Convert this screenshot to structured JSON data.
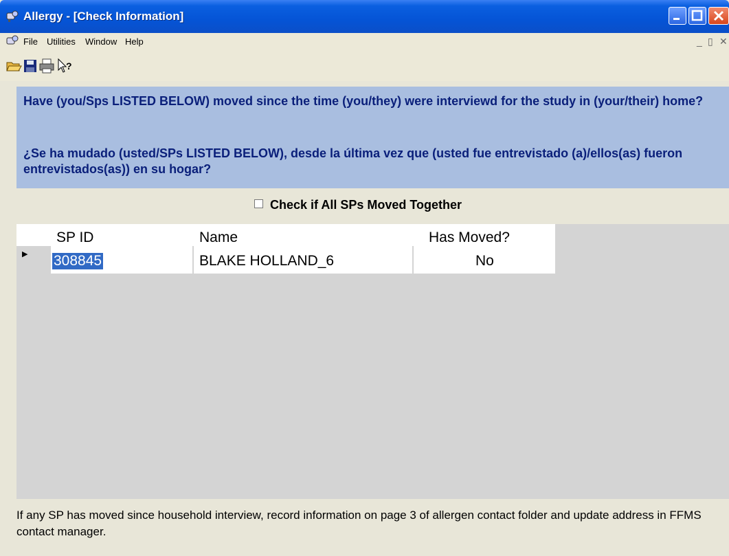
{
  "window": {
    "title": "Allergy - [Check Information]"
  },
  "menu": {
    "items": [
      "File",
      "Utilities",
      "Window",
      "Help"
    ]
  },
  "toolbar": {
    "icons": [
      "open-folder-icon",
      "save-icon",
      "print-icon",
      "context-help-icon"
    ]
  },
  "question": {
    "english": "Have (you/Sps LISTED BELOW) moved since the time (you/they) were interviewd for the study in (your/their) home?",
    "spanish": "¿Se ha mudado (usted/SPs LISTED BELOW), desde la última vez que (usted fue entrevistado (a)/ellos(as) fueron entrevistados(as)) en su hogar?"
  },
  "checkbox": {
    "label": "Check if All SPs Moved Together",
    "checked": false
  },
  "grid": {
    "columns": [
      "SP ID",
      "Name",
      "Has Moved?"
    ],
    "rows": [
      {
        "sp_id": "308845",
        "name": "BLAKE HOLLAND_6",
        "has_moved": "No"
      }
    ]
  },
  "footer_note": "If any SP has moved since household interview, record information on page 3 of allergen contact folder and update address in FFMS contact manager.",
  "colors": {
    "title_bar": "#0554d6",
    "question_bg": "#a9bee0",
    "question_text": "#0a1f7a",
    "selection": "#316ac5"
  }
}
